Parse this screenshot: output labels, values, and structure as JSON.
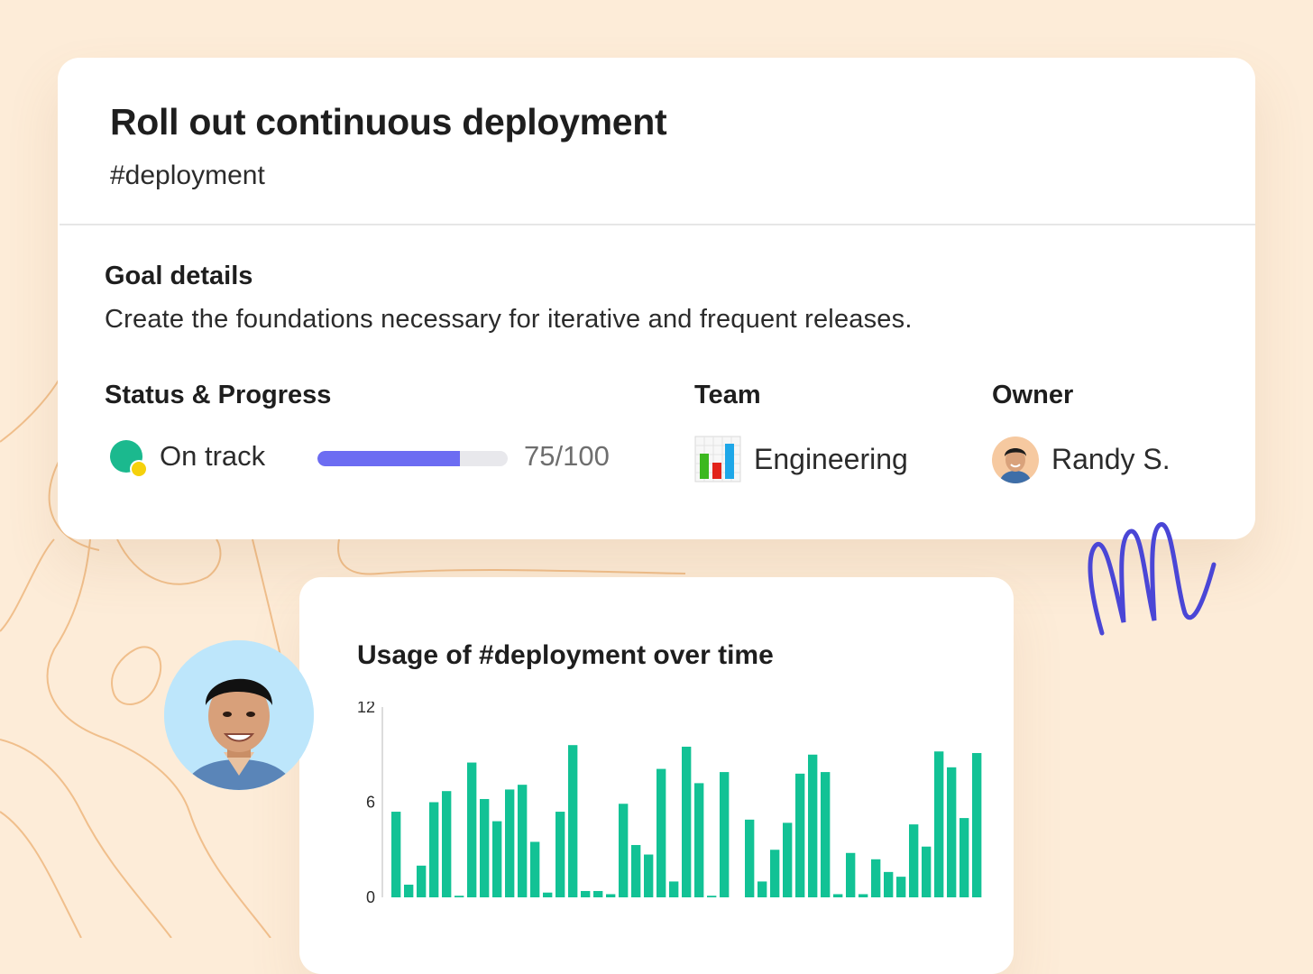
{
  "goal": {
    "title": "Roll out continuous deployment",
    "tag": "#deployment",
    "details_heading": "Goal details",
    "description": "Create the foundations necessary for iterative and frequent releases."
  },
  "status": {
    "heading": "Status & Progress",
    "label": "On track",
    "progress_text": "75/100",
    "progress_fraction": 0.75,
    "icon": "status-on-track-icon",
    "colors": {
      "primary": "#1bb98e",
      "accent": "#f5d10c",
      "bar": "#6c6cf2"
    }
  },
  "team": {
    "heading": "Team",
    "name": "Engineering",
    "icon": "bar-chart-emoji-icon"
  },
  "owner": {
    "heading": "Owner",
    "name": "Randy S."
  },
  "usage": {
    "title": "Usage of #deployment over time"
  },
  "chart_data": {
    "type": "bar",
    "title": "Usage of #deployment over time",
    "ylim": [
      0,
      12
    ],
    "yticks": [
      0,
      6,
      12
    ],
    "color": "#12c295",
    "grid": false,
    "values": [
      5.4,
      0.8,
      2,
      6,
      6.7,
      0.1,
      8.5,
      6.2,
      4.8,
      6.8,
      7.1,
      3.5,
      0.3,
      5.4,
      9.6,
      0.4,
      0.4,
      0.2,
      5.9,
      3.3,
      2.7,
      8.1,
      1,
      9.5,
      7.2,
      0.1,
      7.9,
      null,
      4.9,
      1,
      3,
      4.7,
      7.8,
      9,
      7.9,
      0.2,
      2.8,
      0.2,
      2.4,
      1.6,
      1.3,
      4.6,
      3.2,
      9.2,
      8.2,
      5,
      9.1
    ]
  }
}
